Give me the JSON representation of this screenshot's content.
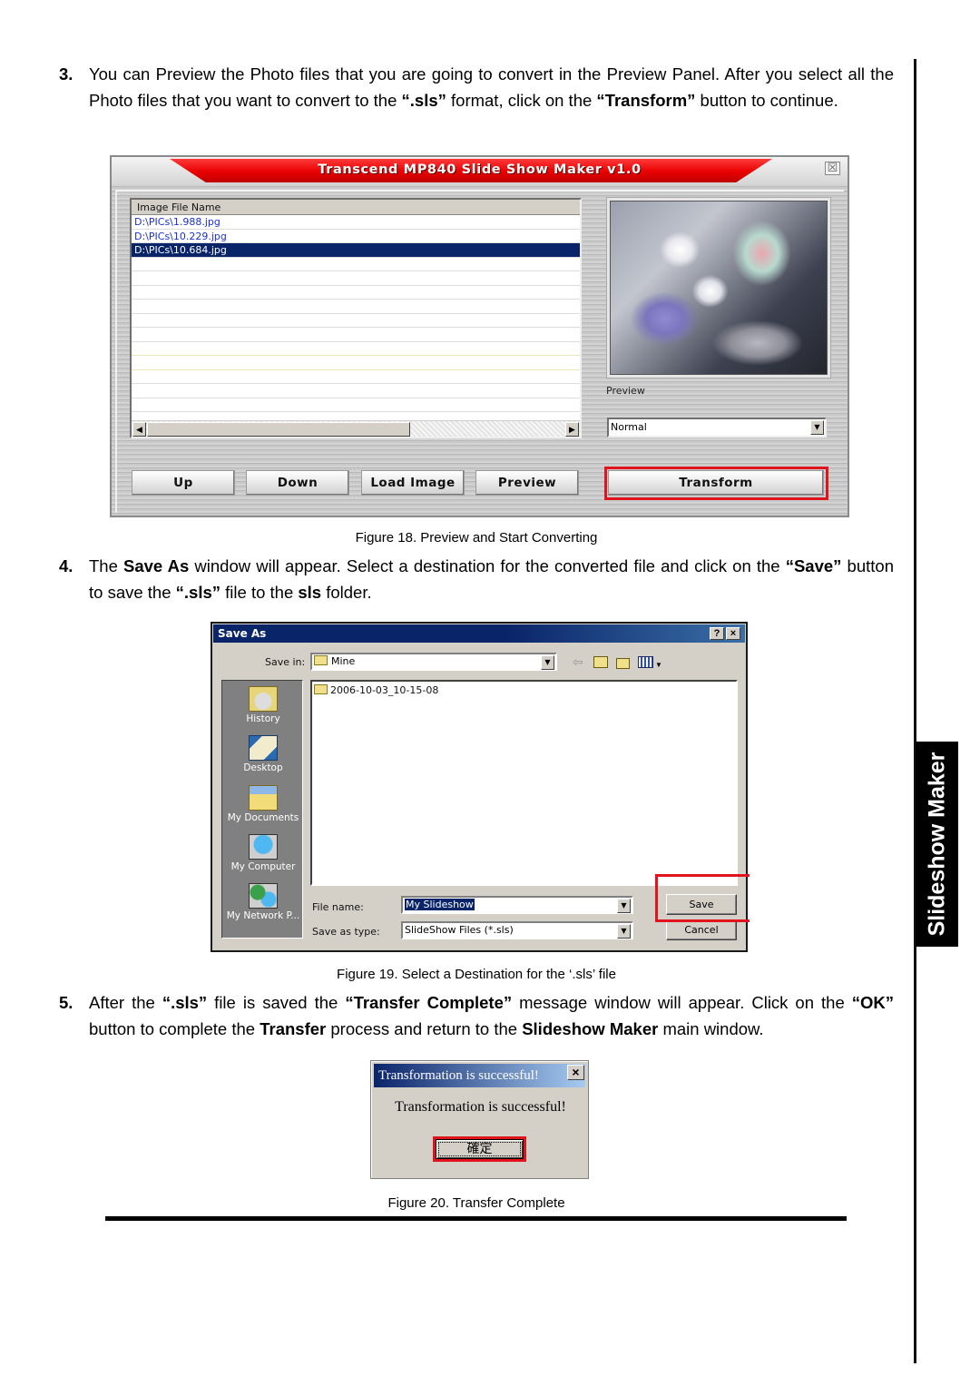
{
  "side_tab": {
    "label": "Slideshow Maker"
  },
  "steps": [
    {
      "number": "3.",
      "segments": [
        {
          "t": "You can Preview the Photo files that you are going to convert in the Preview Panel. After you select all the Photo files that you want to convert to the ",
          "b": false
        },
        {
          "t": "“.sls”",
          "b": true
        },
        {
          "t": " format, click on the ",
          "b": false
        },
        {
          "t": "“Transform”",
          "b": true
        },
        {
          "t": " button to continue.",
          "b": false
        }
      ]
    },
    {
      "number": "4.",
      "segments": [
        {
          "t": "The ",
          "b": false
        },
        {
          "t": "Save As",
          "b": true
        },
        {
          "t": " window will appear. Select a destination for the converted file and click on the ",
          "b": false
        },
        {
          "t": "“Save”",
          "b": true
        },
        {
          "t": " button to save the ",
          "b": false
        },
        {
          "t": "“.sls”",
          "b": true
        },
        {
          "t": " file to the ",
          "b": false
        },
        {
          "t": "sls",
          "b": true
        },
        {
          "t": " folder.",
          "b": false
        }
      ]
    },
    {
      "number": "5.",
      "segments": [
        {
          "t": "After the ",
          "b": false
        },
        {
          "t": "“.sls”",
          "b": true
        },
        {
          "t": " file is saved the ",
          "b": false
        },
        {
          "t": "“Transfer Complete”",
          "b": true
        },
        {
          "t": " message window will appear. Click on the ",
          "b": false
        },
        {
          "t": "“OK”",
          "b": true
        },
        {
          "t": " button to complete the ",
          "b": false
        },
        {
          "t": "Transfer",
          "b": true
        },
        {
          "t": " process and return to the ",
          "b": false
        },
        {
          "t": "Slideshow Maker",
          "b": true
        },
        {
          "t": " main window.",
          "b": false
        }
      ]
    }
  ],
  "figures": {
    "fig18": {
      "caption": "Figure 18. Preview and Start Converting",
      "window_title": "Transcend MP840 Slide Show Maker v1.0",
      "close_glyph": "☒",
      "list_header": "Image File Name",
      "files": [
        "D:\\PICs\\1.988.jpg",
        "D:\\PICs\\10.229.jpg",
        "D:\\PICs\\10.684.jpg"
      ],
      "selected_index": 2,
      "preview_label": "Preview",
      "mode_select": "Normal",
      "buttons": {
        "up": "Up",
        "down": "Down",
        "load_image": "Load Image",
        "preview": "Preview",
        "transform": "Transform"
      },
      "highlight_color": "#e1141d"
    },
    "fig19": {
      "caption": "Figure 19. Select a Destination for the ‘.sls’ file",
      "window_title": "Save As",
      "help_glyph": "?",
      "close_glyph": "×",
      "save_in_label": "Save in:",
      "save_in_value": "Mine",
      "places": [
        "History",
        "Desktop",
        "My Documents",
        "My Computer",
        "My Network P..."
      ],
      "folders": [
        "2006-10-03_10-15-08"
      ],
      "file_name_label": "File name:",
      "file_name_value": "My Slideshow",
      "save_type_label": "Save as type:",
      "save_type_value": "SlideShow Files (*.sls)",
      "save_button": "Save",
      "cancel_button": "Cancel"
    },
    "fig20": {
      "caption": "Figure 20. Transfer Complete",
      "window_title": "Transformation is successful!",
      "message": "Transformation is successful!",
      "ok_button": "確定",
      "close_glyph": "×"
    }
  }
}
